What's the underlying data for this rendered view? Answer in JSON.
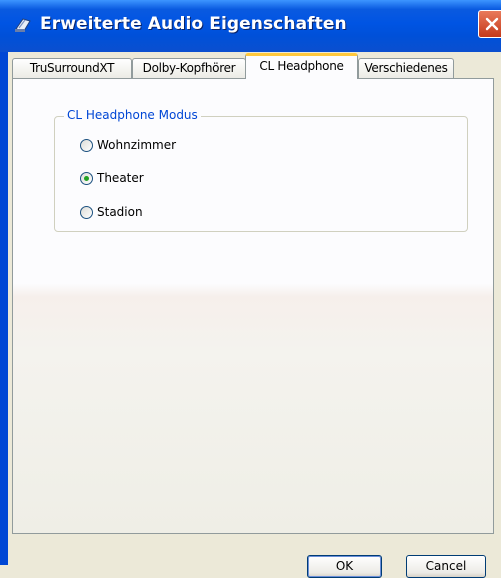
{
  "window": {
    "title": "Erweiterte Audio Eigenschaften",
    "icon": "audio-app-icon",
    "close_icon": "close-icon"
  },
  "tabs": [
    {
      "label": "TruSurroundXT",
      "active": false
    },
    {
      "label": "Dolby-Kopfhörer",
      "active": false
    },
    {
      "label": "CL Headphone",
      "active": true
    },
    {
      "label": "Verschiedenes",
      "active": false
    }
  ],
  "group": {
    "title": "CL Headphone Modus",
    "options": [
      {
        "label": "Wohnzimmer",
        "selected": false
      },
      {
        "label": "Theater",
        "selected": true
      },
      {
        "label": "Stadion",
        "selected": false
      }
    ]
  },
  "buttons": {
    "ok": "OK",
    "cancel": "Cancel"
  },
  "colors": {
    "titlebar": "#0054e3",
    "active_tab_highlight": "#ffc83c",
    "group_title": "#0046d5",
    "radio_selected": "#21a121"
  }
}
